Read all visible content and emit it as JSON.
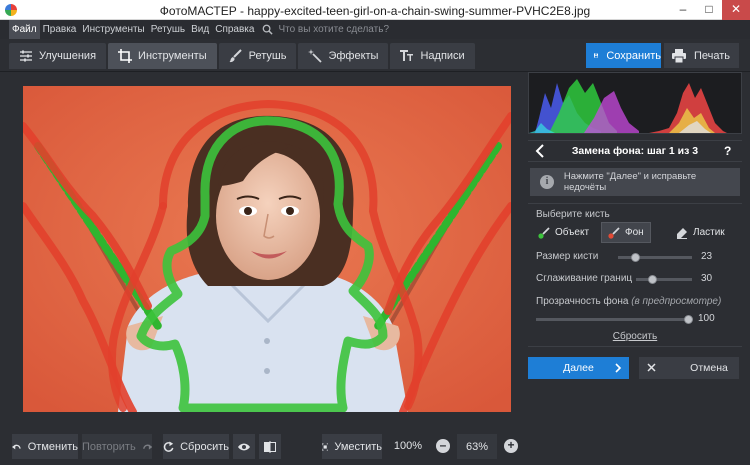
{
  "window": {
    "title": "ФотоМАСТЕР - happy-excited-teen-girl-on-a-chain-swing-summer-PVHC2E8.jpg",
    "minimize": "–",
    "maximize": "□",
    "close": "✕"
  },
  "menu": {
    "items": [
      "Файл",
      "Правка",
      "Инструменты",
      "Ретушь",
      "Вид",
      "Справка"
    ],
    "active": "Файл",
    "search_placeholder": "Что вы хотите сделать?"
  },
  "tabs": [
    {
      "label": "Улучшения",
      "icon": "sliders-icon"
    },
    {
      "label": "Инструменты",
      "icon": "crop-icon",
      "active": true
    },
    {
      "label": "Ретушь",
      "icon": "brush-icon"
    },
    {
      "label": "Эффекты",
      "icon": "magic-wand-icon"
    },
    {
      "label": "Надписи",
      "icon": "text-icon"
    }
  ],
  "toolbar": {
    "save_label": "Сохранить",
    "print_label": "Печать"
  },
  "bottom": {
    "undo_label": "Отменить",
    "redo_label": "Повторить",
    "reset_label": "Сбросить",
    "fit_label": "Уместить",
    "zoom_100": "100%",
    "zoom_value": "63%"
  },
  "panel": {
    "step_title": "Замена фона: шаг 1 из 3",
    "help": "?",
    "info_text": "Нажмите \"Далее\" и исправьте недочёты",
    "brush_heading": "Выберите кисть",
    "brushes": [
      {
        "label": "Объект",
        "icon": "brush-object-icon",
        "color": "#3cc33c"
      },
      {
        "label": "Фон",
        "icon": "brush-background-icon",
        "color": "#e24a35",
        "active": true
      },
      {
        "label": "Ластик",
        "icon": "eraser-icon"
      }
    ],
    "brush_size_label": "Размер кисти",
    "brush_size_value": "23",
    "brush_size_fraction": 0.23,
    "smoothing_label": "Сглаживание границ",
    "smoothing_value": "30",
    "smoothing_fraction": 0.3,
    "transparency_label": "Прозрачность фона",
    "transparency_note": "(в предпросмотре)",
    "transparency_value": "100",
    "transparency_fraction": 1.0,
    "reset_label": "Сбросить",
    "next_label": "Далее",
    "cancel_label": "Отмена"
  },
  "colors": {
    "accent": "#1e7ed6",
    "object_stroke": "#3cc33c",
    "background_stroke": "#e2402c",
    "photo_background": "#e46b45"
  }
}
